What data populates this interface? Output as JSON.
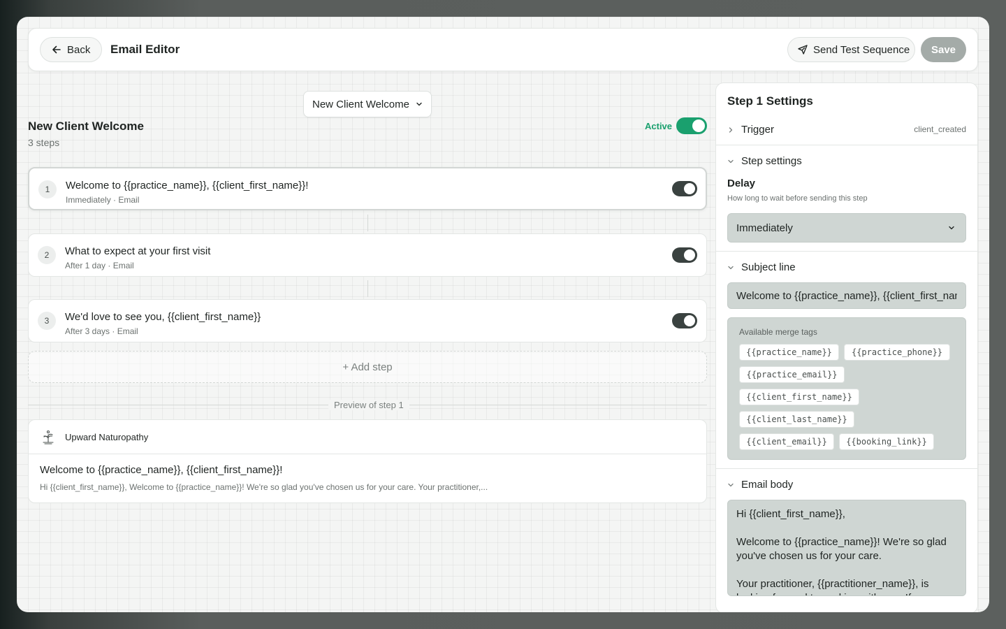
{
  "header": {
    "back_label": "Back",
    "title": "Email Editor",
    "send_test_label": "Send Test Sequence",
    "save_label": "Save"
  },
  "sequence": {
    "selector_value": "New Client Welcome",
    "name": "New Client Welcome",
    "steps_count": "3 steps",
    "status_label": "Active",
    "status_on": true
  },
  "steps": [
    {
      "number": "1",
      "title": "Welcome to {{practice_name}}, {{client_first_name}}!",
      "meta": "Immediately · Email",
      "enabled": true
    },
    {
      "number": "2",
      "title": "What to expect at your first visit",
      "meta": "After 1 day · Email",
      "enabled": true
    },
    {
      "number": "3",
      "title": "We'd love to see you, {{client_first_name}}",
      "meta": "After 3 days · Email",
      "enabled": true
    }
  ],
  "add_step_label": "+ Add step",
  "preview": {
    "label": "Preview of step 1",
    "practice_name": "Upward Naturopathy",
    "subject": "Welcome to {{practice_name}}, {{client_first_name}}!",
    "snippet": "Hi {{client_first_name}}, Welcome to {{practice_name}}! We're so glad you've chosen us for your care. Your practitioner,..."
  },
  "settings": {
    "title": "Step 1 Settings",
    "trigger_label": "Trigger",
    "trigger_value": "client_created",
    "step_settings_label": "Step settings",
    "delay_label": "Delay",
    "delay_help": "How long to wait before sending this step",
    "delay_value": "Immediately",
    "subject_label": "Subject line",
    "subject_value": "Welcome to {{practice_name}}, {{client_first_name}}!",
    "merge_tags_title": "Available merge tags",
    "merge_tags": [
      "{{practice_name}}",
      "{{practice_phone}}",
      "{{practice_email}}",
      "{{client_first_name}}",
      "{{client_last_name}}",
      "{{client_email}}",
      "{{booking_link}}"
    ],
    "body_label": "Email body",
    "body_paragraphs": [
      "Hi {{client_first_name}},",
      "Welcome to {{practice_name}}! We're so glad you've chosen us for your care.",
      "Your practitioner, {{practitioner_name}}, is looking forward to working with you. If you"
    ]
  },
  "colors": {
    "accent_green": "#1aa06e",
    "toggle_dark": "#3a4240",
    "field_bg": "#cfd6d3"
  }
}
